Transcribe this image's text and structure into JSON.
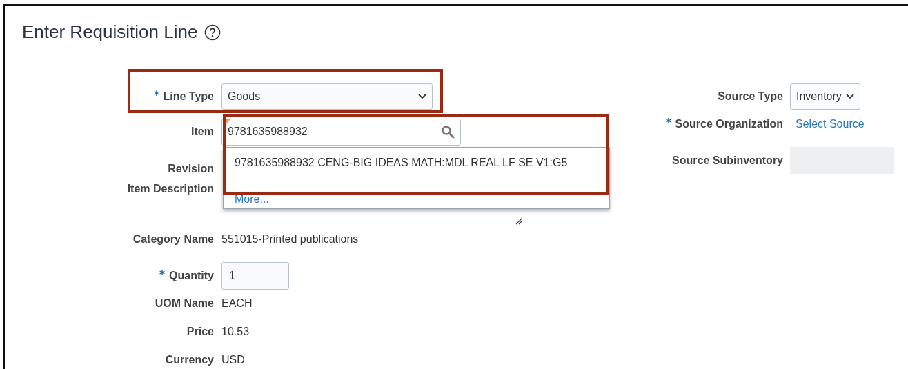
{
  "title": "Enter Requisition Line",
  "left_fields": [
    {
      "label": "Line Type",
      "required": true,
      "kind": "select",
      "value": "Goods"
    },
    {
      "label": "Item",
      "required": false,
      "kind": "search",
      "value": "9781635988932"
    },
    {
      "label": "Revision",
      "required": false,
      "kind": "covered"
    },
    {
      "label": "Item Description",
      "required": false,
      "kind": "textarea"
    },
    {
      "label": "Category Name",
      "required": false,
      "kind": "text",
      "value": "551015-Printed publications"
    },
    {
      "label": "Quantity",
      "required": true,
      "kind": "input",
      "value": "1"
    },
    {
      "label": "UOM Name",
      "required": false,
      "kind": "text",
      "value": "EACH"
    },
    {
      "label": "Price",
      "required": false,
      "kind": "text",
      "value": "10.53"
    },
    {
      "label": "Currency",
      "required": false,
      "kind": "text",
      "value": "USD"
    }
  ],
  "right_fields": [
    {
      "label": "Source Type",
      "required": false,
      "has_help_note": true,
      "kind": "select",
      "value": "Inventory"
    },
    {
      "label": "Source Organization",
      "required": true,
      "has_help_note": false,
      "kind": "link",
      "value": "Select Source"
    },
    {
      "label": "Source Subinventory",
      "required": false,
      "has_help_note": false,
      "kind": "readonly"
    }
  ],
  "item_suggestions": {
    "options": [
      "9781635988932 CENG-BIG IDEAS MATH:MDL REAL LF SE V1:G5"
    ],
    "more_link": "More..."
  }
}
